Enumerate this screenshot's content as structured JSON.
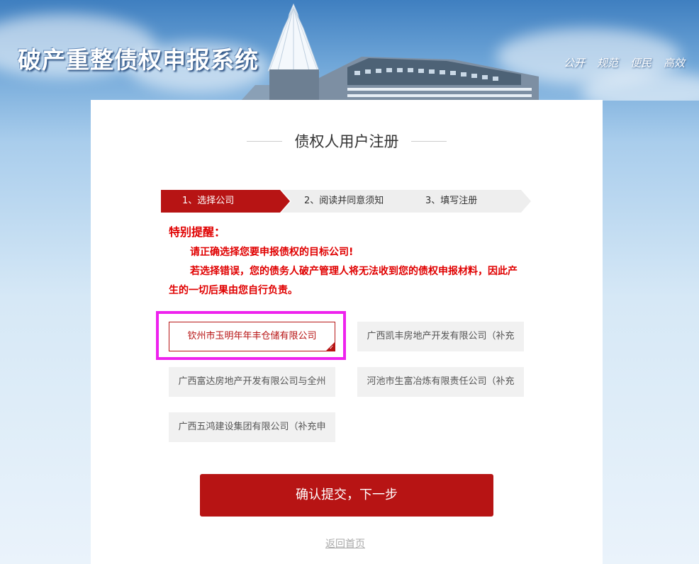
{
  "header": {
    "site_title": "破产重整债权申报系统",
    "slogans": [
      "公开",
      "规范",
      "便民",
      "高效"
    ]
  },
  "page_title": "债权人用户注册",
  "steps": [
    {
      "label": "1、选择公司",
      "active": true
    },
    {
      "label": "2、阅读并同意须知",
      "active": false
    },
    {
      "label": "3、填写注册",
      "active": false
    }
  ],
  "notice": {
    "title": "特别提醒：",
    "line1": "请正确选择您要申报债权的目标公司!",
    "line2": "若选择错误，您的债务人破产管理人将无法收到您的债权申报材料，因此产生的一切后果由您自行负责。"
  },
  "companies": [
    {
      "name": "钦州市玉明年年丰仓储有限公司",
      "selected": true
    },
    {
      "name": "广西凯丰房地产开发有限公司（补充",
      "selected": false
    },
    {
      "name": "广西富达房地产开发有限公司与全州",
      "selected": false
    },
    {
      "name": "河池市生富冶炼有限责任公司（补充",
      "selected": false
    },
    {
      "name": "广西五鸿建设集团有限公司（补充申",
      "selected": false
    }
  ],
  "submit_label": "确认提交，下一步",
  "back_link": "返回首页",
  "colors": {
    "primary": "#b71414",
    "warning": "#e00000",
    "highlight": "#ee22ee"
  }
}
